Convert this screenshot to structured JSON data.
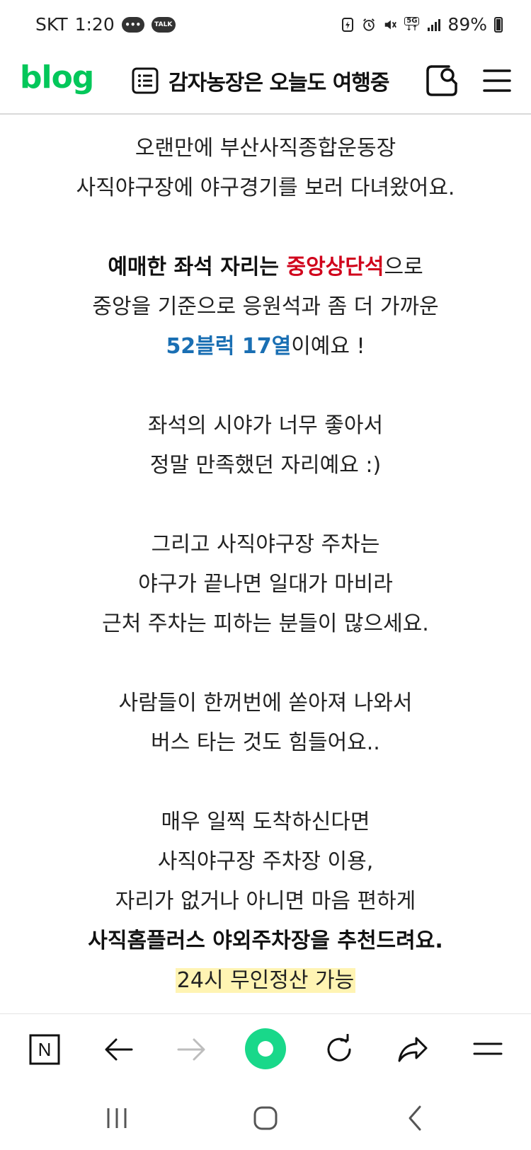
{
  "status_bar": {
    "carrier": "SKT",
    "time": "1:20",
    "talk_badge": "TALK",
    "network": "5G",
    "battery": "89%"
  },
  "header": {
    "logo": "blog",
    "blog_title": "감자농장은 오늘도 여행중"
  },
  "content": {
    "p1": [
      "오랜만에 부산사직종합운동장",
      "사직야구장에 야구경기를 보러 다녀왔어요."
    ],
    "p2": {
      "l1_bold": "예매한 좌석 자리는 ",
      "l1_red": "중앙상단석",
      "l1_tail": "으로",
      "l2": "중앙을 기준으로 응원석과 좀 더 가까운",
      "l3_blue": "52블럭 17열",
      "l3_tail": "이예요 !"
    },
    "p3": [
      "좌석의 시야가 너무 좋아서",
      "정말 만족했던 자리예요 :)"
    ],
    "p4": [
      "그리고 사직야구장 주차는",
      "야구가 끝나면 일대가 마비라",
      "근처 주차는 피하는 분들이 많으세요."
    ],
    "p5": [
      "사람들이 한꺼번에 쏟아져 나와서",
      "버스 타는 것도 힘들어요.."
    ],
    "p6": {
      "l1": "매우 일찍 도착하신다면",
      "l2": "사직야구장 주차장 이용,",
      "l3": "자리가 없거나 아니면 마음 편하게",
      "l4_bold": "사직홈플러스 야외주차장을 추천드려요.",
      "l5_highlight": "24시 무인정산 가능"
    }
  },
  "toolbar": {
    "n_label": "N"
  },
  "colors": {
    "brand_green": "#03c75a",
    "accent_red": "#d0021b",
    "accent_blue": "#1a6fb3",
    "highlight_yellow": "#fff4b3"
  }
}
